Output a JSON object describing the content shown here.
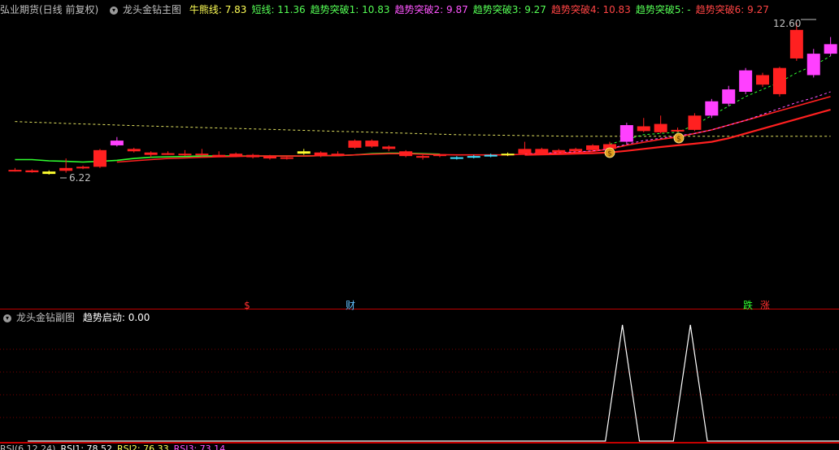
{
  "main_header": {
    "title": "弘业期货(日线 前复权)",
    "indicator_name": "龙头金钻主图",
    "items": [
      {
        "label": "牛熊线: 7.83",
        "color": "#ffff55"
      },
      {
        "label": "短线: 11.36",
        "color": "#55ff55"
      },
      {
        "label": "趋势突破1: 10.83",
        "color": "#55ff55"
      },
      {
        "label": "趋势突破2: 9.87",
        "color": "#ff55ff"
      },
      {
        "label": "趋势突破3: 9.27",
        "color": "#55ff55"
      },
      {
        "label": "趋势突破4: 10.83",
        "color": "#ff4444"
      },
      {
        "label": "趋势突破5: -",
        "color": "#55ff55"
      },
      {
        "label": "趋势突破6: 9.27",
        "color": "#ff4444"
      }
    ]
  },
  "sub_header": {
    "indicator_name": "龙头金钻副图",
    "label": "趋势启动: 0.00",
    "label_color": "#ffffff"
  },
  "markers": {
    "high_label": "12.60",
    "low_label": "6.22",
    "signal_dollar": "$",
    "signal_cai": "财",
    "signal_die": "跌",
    "signal_zhang": "涨"
  },
  "bottom_strip": [
    {
      "label": "RSI(6,12,24)",
      "color": "#c0c0c0"
    },
    {
      "label": "RSI1: 78.52",
      "color": "#ffffff"
    },
    {
      "label": "RSI2: 76.33",
      "color": "#ffff55"
    },
    {
      "label": "RSI3: 73.14",
      "color": "#ff55ff"
    }
  ],
  "chart_data": [
    {
      "type": "candlestick",
      "title": "龙头金钻主图",
      "ylim": [
        5.4,
        13.2
      ],
      "candles": [
        {
          "o": 6.4,
          "c": 6.42,
          "h": 6.5,
          "l": 6.35,
          "color": "#ff2020"
        },
        {
          "o": 6.4,
          "c": 6.32,
          "h": 6.45,
          "l": 6.3,
          "color": "#ff2020"
        },
        {
          "o": 6.35,
          "c": 6.25,
          "h": 6.4,
          "l": 6.22,
          "color": "#ffff30"
        },
        {
          "o": 6.38,
          "c": 6.5,
          "h": 6.9,
          "l": 6.3,
          "color": "#ff2020"
        },
        {
          "o": 6.5,
          "c": 6.55,
          "h": 6.6,
          "l": 6.45,
          "color": "#ff2020"
        },
        {
          "o": 6.55,
          "c": 7.25,
          "h": 7.3,
          "l": 6.5,
          "color": "#ff2020"
        },
        {
          "o": 7.45,
          "c": 7.65,
          "h": 7.8,
          "l": 7.4,
          "color": "#ff40ff"
        },
        {
          "o": 7.3,
          "c": 7.2,
          "h": 7.35,
          "l": 7.15,
          "color": "#ff2020"
        },
        {
          "o": 7.15,
          "c": 7.05,
          "h": 7.2,
          "l": 6.95,
          "color": "#ff2020"
        },
        {
          "o": 7.08,
          "c": 7.12,
          "h": 7.2,
          "l": 7.05,
          "color": "#ff2020"
        },
        {
          "o": 7.1,
          "c": 7.05,
          "h": 7.25,
          "l": 7.0,
          "color": "#ff2020"
        },
        {
          "o": 7.06,
          "c": 7.1,
          "h": 7.3,
          "l": 7.0,
          "color": "#ff2020"
        },
        {
          "o": 7.05,
          "c": 7.0,
          "h": 7.2,
          "l": 6.95,
          "color": "#ff2020"
        },
        {
          "o": 7.0,
          "c": 7.1,
          "h": 7.15,
          "l": 6.95,
          "color": "#ff2020"
        },
        {
          "o": 7.05,
          "c": 6.95,
          "h": 7.1,
          "l": 6.9,
          "color": "#ff2020"
        },
        {
          "o": 7.0,
          "c": 6.9,
          "h": 7.05,
          "l": 6.85,
          "color": "#ff2020"
        },
        {
          "o": 6.95,
          "c": 6.9,
          "h": 7.0,
          "l": 6.85,
          "color": "#ff2020"
        },
        {
          "o": 7.1,
          "c": 7.2,
          "h": 7.3,
          "l": 7.05,
          "color": "#ffff30"
        },
        {
          "o": 7.0,
          "c": 7.15,
          "h": 7.2,
          "l": 6.95,
          "color": "#ff2020"
        },
        {
          "o": 7.1,
          "c": 7.05,
          "h": 7.2,
          "l": 7.0,
          "color": "#ff2020"
        },
        {
          "o": 7.35,
          "c": 7.65,
          "h": 7.7,
          "l": 7.3,
          "color": "#ff2020"
        },
        {
          "o": 7.4,
          "c": 7.65,
          "h": 7.7,
          "l": 7.35,
          "color": "#ff2020"
        },
        {
          "o": 7.3,
          "c": 7.4,
          "h": 7.45,
          "l": 7.2,
          "color": "#ff2020"
        },
        {
          "o": 7.2,
          "c": 7.0,
          "h": 7.25,
          "l": 6.95,
          "color": "#ff2020"
        },
        {
          "o": 7.0,
          "c": 6.95,
          "h": 7.05,
          "l": 6.85,
          "color": "#ff2020"
        },
        {
          "o": 7.0,
          "c": 7.08,
          "h": 7.1,
          "l": 6.95,
          "color": "#ff2020"
        },
        {
          "o": 6.9,
          "c": 6.95,
          "h": 7.0,
          "l": 6.85,
          "color": "#40e0ff"
        },
        {
          "o": 6.95,
          "c": 7.0,
          "h": 7.05,
          "l": 6.9,
          "color": "#40e0ff"
        },
        {
          "o": 7.0,
          "c": 7.05,
          "h": 7.1,
          "l": 6.95,
          "color": "#40e0ff"
        },
        {
          "o": 7.05,
          "c": 7.1,
          "h": 7.15,
          "l": 7.0,
          "color": "#ffff30"
        },
        {
          "o": 7.1,
          "c": 7.3,
          "h": 7.6,
          "l": 7.05,
          "color": "#ff2020"
        },
        {
          "o": 7.1,
          "c": 7.3,
          "h": 7.35,
          "l": 7.05,
          "color": "#ff2020"
        },
        {
          "o": 7.15,
          "c": 7.25,
          "h": 7.3,
          "l": 7.1,
          "color": "#ff2020"
        },
        {
          "o": 7.2,
          "c": 7.3,
          "h": 7.35,
          "l": 7.15,
          "color": "#ff2020"
        },
        {
          "o": 7.25,
          "c": 7.45,
          "h": 7.5,
          "l": 7.2,
          "color": "#ff2020"
        },
        {
          "o": 7.3,
          "c": 7.5,
          "h": 7.6,
          "l": 7.25,
          "color": "#ff2020"
        },
        {
          "o": 7.6,
          "c": 8.3,
          "h": 8.4,
          "l": 7.5,
          "color": "#ff40ff"
        },
        {
          "o": 8.05,
          "c": 8.25,
          "h": 8.6,
          "l": 8.0,
          "color": "#ff2020"
        },
        {
          "o": 8.0,
          "c": 8.35,
          "h": 8.7,
          "l": 7.95,
          "color": "#ff2020"
        },
        {
          "o": 8.05,
          "c": 8.1,
          "h": 8.2,
          "l": 8.0,
          "color": "#ff2020"
        },
        {
          "o": 8.1,
          "c": 8.7,
          "h": 8.8,
          "l": 8.05,
          "color": "#ff2020"
        },
        {
          "o": 8.7,
          "c": 9.3,
          "h": 9.4,
          "l": 8.6,
          "color": "#ff40ff"
        },
        {
          "o": 9.2,
          "c": 9.8,
          "h": 9.95,
          "l": 9.1,
          "color": "#ff40ff"
        },
        {
          "o": 9.7,
          "c": 10.6,
          "h": 10.7,
          "l": 9.6,
          "color": "#ff40ff"
        },
        {
          "o": 10.0,
          "c": 10.4,
          "h": 10.5,
          "l": 9.9,
          "color": "#ff2020"
        },
        {
          "o": 10.7,
          "c": 9.6,
          "h": 10.75,
          "l": 9.5,
          "color": "#ff2020"
        },
        {
          "o": 11.1,
          "c": 12.3,
          "h": 12.6,
          "l": 11.0,
          "color": "#ff2020"
        },
        {
          "o": 10.4,
          "c": 11.3,
          "h": 11.5,
          "l": 10.3,
          "color": "#ff40ff"
        },
        {
          "o": 11.3,
          "c": 11.7,
          "h": 12.0,
          "l": 11.2,
          "color": "#ff40ff"
        }
      ],
      "lines": [
        {
          "name": "牛熊线",
          "color": "#e0e060",
          "dash": true,
          "values": [
            8.45,
            8.42,
            8.4,
            8.37,
            8.35,
            8.33,
            8.3,
            8.28,
            8.26,
            8.24,
            8.22,
            8.2,
            8.18,
            8.16,
            8.14,
            8.12,
            8.1,
            8.08,
            8.06,
            8.04,
            8.02,
            8.0,
            7.98,
            7.96,
            7.94,
            7.92,
            7.9,
            7.89,
            7.88,
            7.87,
            7.86,
            7.85,
            7.84,
            7.83,
            7.83,
            7.83,
            7.83,
            7.83,
            7.83,
            7.83,
            7.83,
            7.83,
            7.83,
            7.83,
            7.83,
            7.83,
            7.83,
            7.83,
            7.83
          ]
        },
        {
          "name": "短线",
          "color": "#30ff30",
          "dash": false,
          "values": [
            6.85,
            6.85,
            6.8,
            6.78,
            6.75,
            6.78,
            6.82,
            6.9,
            6.95,
            6.97,
            6.98,
            7.0,
            7.0,
            7.0,
            7.0,
            7.0,
            7.0,
            7.0,
            7.02,
            7.02,
            7.05,
            7.1,
            7.12,
            7.12,
            7.1,
            7.08,
            null,
            null,
            null,
            null,
            null,
            null,
            null,
            null,
            null,
            null,
            null,
            null,
            null,
            null,
            null,
            null,
            null,
            null,
            null,
            null,
            null,
            null,
            null
          ]
        },
        {
          "name": "趋势突破1",
          "color": "#ff2020",
          "dash": false,
          "values": [
            null,
            null,
            null,
            null,
            null,
            null,
            6.75,
            6.8,
            6.85,
            6.9,
            6.92,
            6.95,
            6.97,
            6.98,
            7.0,
            7.0,
            7.0,
            7.0,
            7.02,
            7.02,
            7.05,
            7.08,
            7.1,
            7.1,
            7.08,
            7.06,
            7.05,
            7.05,
            7.05,
            7.05,
            7.08,
            7.1,
            7.12,
            7.15,
            7.2,
            7.3,
            7.45,
            7.58,
            7.7,
            7.8,
            7.95,
            8.1,
            8.3,
            8.5,
            8.7,
            8.9,
            9.1,
            9.3,
            9.5
          ]
        },
        {
          "name": "趋势突破2",
          "color": "#ff55ff",
          "dash": true,
          "values": [
            null,
            null,
            null,
            null,
            null,
            null,
            null,
            null,
            null,
            null,
            null,
            null,
            null,
            null,
            null,
            null,
            null,
            null,
            null,
            null,
            null,
            null,
            null,
            null,
            null,
            null,
            null,
            null,
            null,
            null,
            7.1,
            7.12,
            7.15,
            7.18,
            7.22,
            7.3,
            7.5,
            7.65,
            7.75,
            7.85,
            7.95,
            8.1,
            8.3,
            8.5,
            8.75,
            9.0,
            9.25,
            9.45,
            9.7
          ]
        },
        {
          "name": "趋势突破6",
          "color": "#ff2020",
          "dash": false,
          "thick": true,
          "values": [
            null,
            null,
            null,
            null,
            null,
            null,
            null,
            null,
            null,
            null,
            null,
            null,
            null,
            null,
            null,
            null,
            null,
            null,
            null,
            null,
            null,
            null,
            null,
            null,
            null,
            null,
            null,
            null,
            null,
            null,
            7.05,
            7.07,
            7.08,
            7.1,
            7.12,
            7.15,
            7.22,
            7.3,
            7.38,
            7.45,
            7.52,
            7.6,
            7.75,
            7.95,
            8.15,
            8.35,
            8.55,
            8.75,
            8.95
          ]
        },
        {
          "name": "短线2",
          "color": "#30ff30",
          "dash": true,
          "values": [
            null,
            null,
            null,
            null,
            null,
            null,
            null,
            null,
            null,
            null,
            null,
            null,
            null,
            null,
            null,
            null,
            null,
            null,
            null,
            null,
            null,
            null,
            null,
            null,
            null,
            null,
            null,
            null,
            null,
            null,
            null,
            null,
            null,
            null,
            null,
            7.5,
            7.7,
            7.9,
            7.95,
            8.0,
            8.3,
            8.7,
            9.1,
            9.5,
            9.8,
            10.1,
            10.5,
            10.8,
            11.2
          ]
        }
      ]
    },
    {
      "type": "line",
      "title": "龙头金钻副图",
      "series": [
        {
          "name": "趋势启动",
          "color": "#ffffff",
          "values": [
            0,
            0,
            0,
            0,
            0,
            0,
            0,
            0,
            0,
            0,
            0,
            0,
            0,
            0,
            0,
            0,
            0,
            0,
            0,
            0,
            0,
            0,
            0,
            0,
            0,
            0,
            0,
            0,
            0,
            0,
            0,
            0,
            0,
            0,
            0,
            1,
            0,
            0,
            0,
            1,
            0,
            0,
            0,
            0,
            0,
            0,
            0,
            0,
            0
          ]
        }
      ],
      "ylim": [
        0,
        1
      ]
    }
  ]
}
